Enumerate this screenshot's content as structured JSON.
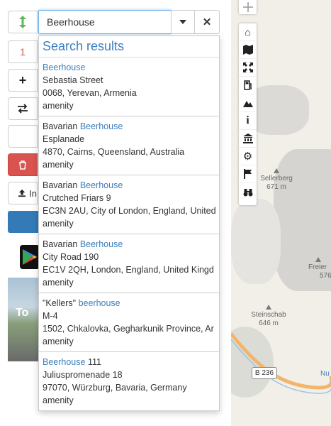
{
  "search": {
    "value": "Beerhouse"
  },
  "left_buttons": {
    "count_label": "1",
    "import_label": "In"
  },
  "results": {
    "title": "Search results",
    "items": [
      {
        "prefix": "",
        "match": "Beerhouse",
        "suffix": "",
        "line2": "Sebastia Street",
        "line3": "0068, Yerevan, Armenia",
        "type": "amenity"
      },
      {
        "prefix": "Bavarian ",
        "match": "Beerhouse",
        "suffix": "",
        "line2": "Esplanade",
        "line3": "4870, Cairns, Queensland, Australia",
        "type": "amenity"
      },
      {
        "prefix": "Bavarian ",
        "match": "Beerhouse",
        "suffix": "",
        "line2": "Crutched Friars 9",
        "line3": "EC3N 2AU, City of London, England, United",
        "type": "amenity"
      },
      {
        "prefix": "Bavarian ",
        "match": "Beerhouse",
        "suffix": "",
        "line2": "City Road 190",
        "line3": "EC1V 2QH, London, England, United Kingd",
        "type": "amenity"
      },
      {
        "prefix": "\"Kellers\" ",
        "match": "beerhouse",
        "suffix": "",
        "line2": "M-4",
        "line3": "1502, Chkalovka, Gegharkunik Province, Ar",
        "type": "amenity"
      },
      {
        "prefix": "",
        "match": "Beerhouse",
        "suffix": " 111",
        "line2": "Juliuspromenade 18",
        "line3": "97070, Würzburg, Bavaria, Germany",
        "type": "amenity"
      }
    ]
  },
  "map": {
    "peaks": [
      {
        "name": "Sellerberg",
        "elev": "671 m"
      },
      {
        "name": "Steinschab",
        "elev": "646 m"
      },
      {
        "name": "Freier",
        "elev": "576"
      }
    ],
    "road_label": "B 236",
    "river_label": "Nu"
  },
  "promo": {
    "text": "To"
  },
  "colors": {
    "accent": "#3d7fbf",
    "danger": "#d9534f",
    "primary": "#337ab7",
    "green": "#5cb85c"
  }
}
